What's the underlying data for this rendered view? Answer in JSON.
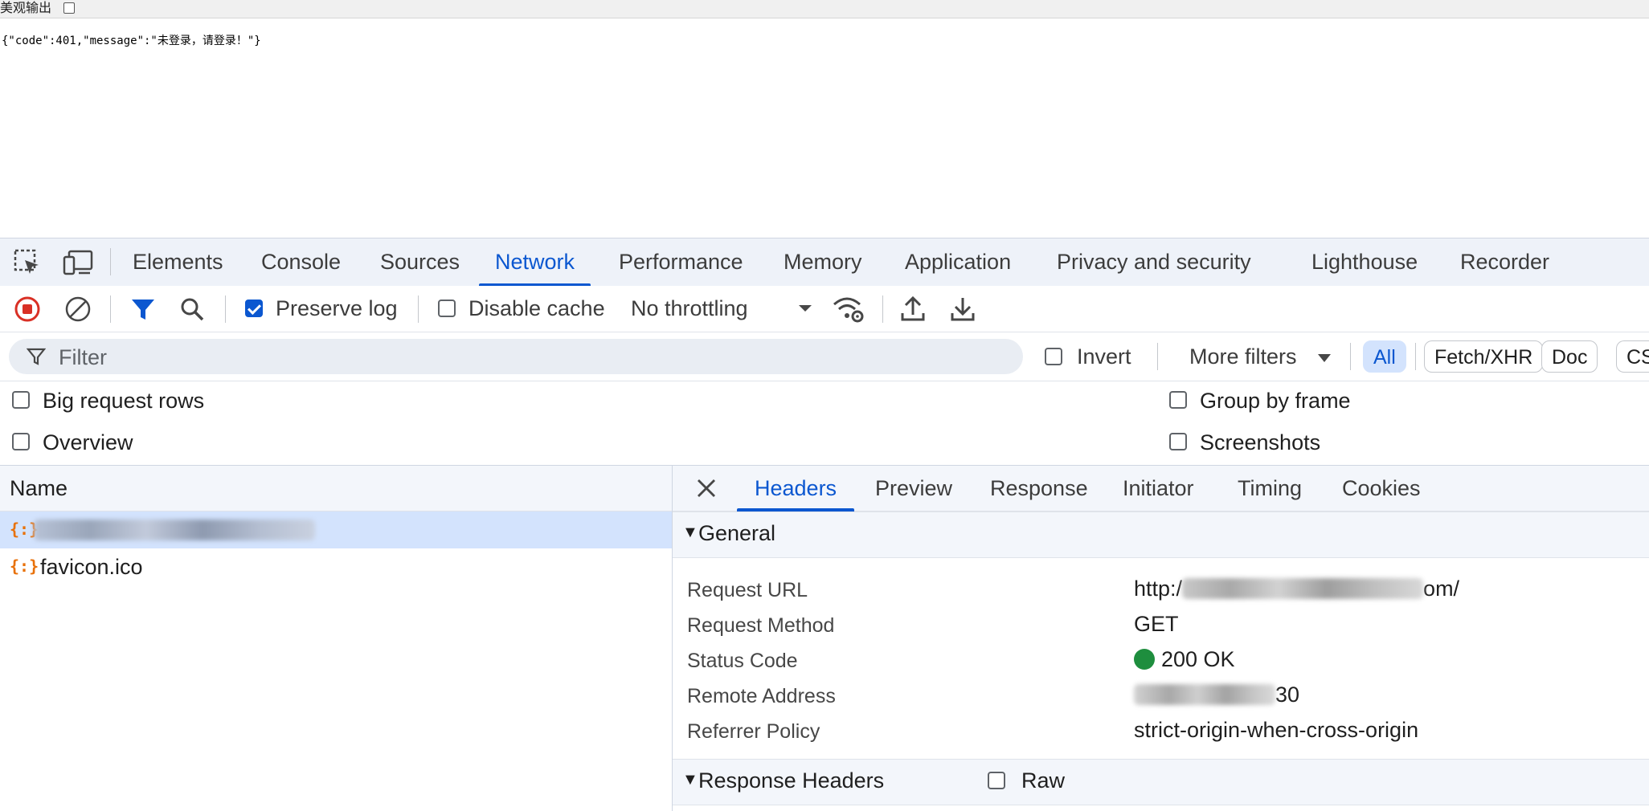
{
  "page": {
    "pretty_print_label": "美观输出",
    "json_text": "{\"code\":401,\"message\":\"未登录，请登录！\"}"
  },
  "devtools": {
    "main_tabs": [
      "Elements",
      "Console",
      "Sources",
      "Network",
      "Performance",
      "Memory",
      "Application",
      "Privacy and security",
      "Lighthouse",
      "Recorder"
    ],
    "active_tab": "Network",
    "toolbar": {
      "preserve_log_label": "Preserve log",
      "preserve_log_checked": true,
      "disable_cache_label": "Disable cache",
      "disable_cache_checked": false,
      "throttling_value": "No throttling"
    },
    "filter": {
      "placeholder": "Filter",
      "invert_label": "Invert",
      "more_filters_label": "More filters",
      "type_chips": [
        "All",
        "Fetch/XHR",
        "Doc",
        "CS"
      ]
    },
    "options": {
      "big_request_rows": "Big request rows",
      "overview": "Overview",
      "group_by_frame": "Group by frame",
      "screenshots": "Screenshots"
    },
    "requests": {
      "column_name": "Name",
      "rows": [
        {
          "name": "",
          "redacted": true,
          "selected": true
        },
        {
          "name": "favicon.ico",
          "redacted": false,
          "selected": false
        }
      ]
    },
    "details": {
      "tabs": [
        "Headers",
        "Preview",
        "Response",
        "Initiator",
        "Timing",
        "Cookies"
      ],
      "active_tab": "Headers",
      "general_title": "General",
      "general": [
        {
          "key": "Request URL",
          "value_prefix": "http:/",
          "value_suffix": "om/"
        },
        {
          "key": "Request Method",
          "value": "GET"
        },
        {
          "key": "Status Code",
          "value": "200 OK",
          "status_color": "#1e8e3e"
        },
        {
          "key": "Remote Address",
          "value_suffix": "30"
        },
        {
          "key": "Referrer Policy",
          "value": "strict-origin-when-cross-origin"
        }
      ],
      "response_headers_title": "Response Headers",
      "raw_label": "Raw"
    }
  },
  "colors": {
    "accent": "#0b57d0",
    "record_red": "#d93025",
    "tab_bar_bg": "#eef2f9",
    "selected_row_bg": "#d3e3fd"
  }
}
